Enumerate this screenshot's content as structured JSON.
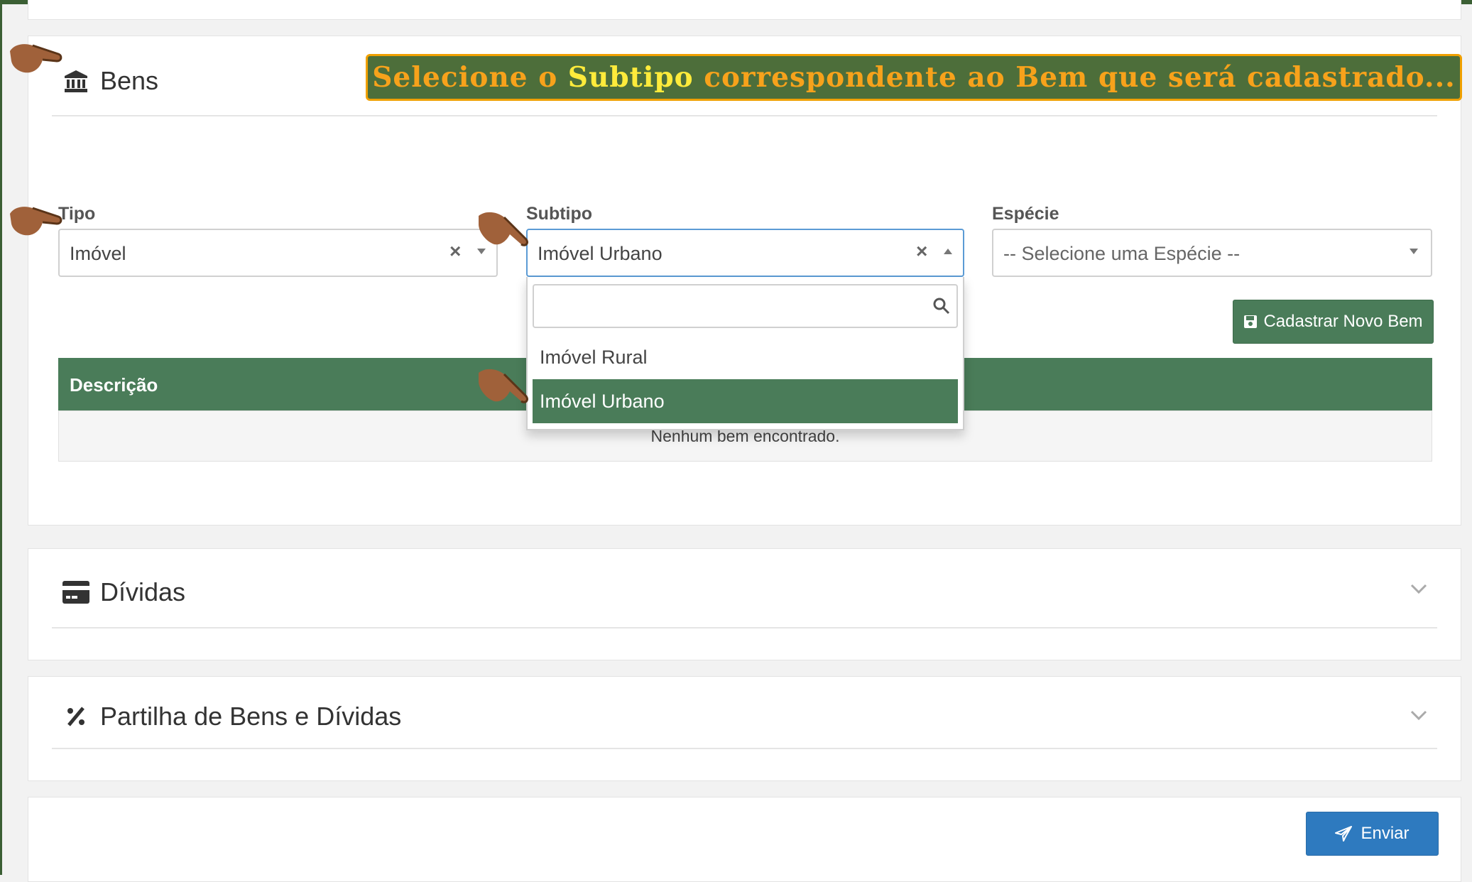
{
  "banner": {
    "before": "Selecione o ",
    "highlight": "Subtipo",
    "after": " correspondente ao Bem que será cadastrado..."
  },
  "bens": {
    "title": "Bens",
    "tipo": {
      "label": "Tipo",
      "value": "Imóvel"
    },
    "subtipo": {
      "label": "Subtipo",
      "value": "Imóvel Urbano",
      "search_value": "",
      "options": [
        "Imóvel Rural",
        "Imóvel Urbano"
      ]
    },
    "especie": {
      "label": "Espécie",
      "placeholder": "-- Selecione uma Espécie --"
    },
    "new_button": "Cadastrar Novo Bem",
    "table": {
      "header": "Descrição",
      "empty_text": "Nenhum bem encontrado."
    }
  },
  "dividas": {
    "title": "Dívidas"
  },
  "partilha": {
    "title": "Partilha de Bens e Dívidas"
  },
  "submit_button": "Enviar",
  "colors": {
    "accent": "#4a7c59",
    "primary": "#2e7abf",
    "banner_bg": "#4d6e3a",
    "banner_text": "#f7a21b",
    "highlight": "#ffeb3b"
  },
  "icons": [
    "bank-icon",
    "credit-card-icon",
    "percent-icon",
    "chevron-down-icon",
    "chevron-up-icon",
    "search-icon",
    "floppy-disk-icon",
    "paper-plane-icon",
    "pointing-hand-icon"
  ]
}
